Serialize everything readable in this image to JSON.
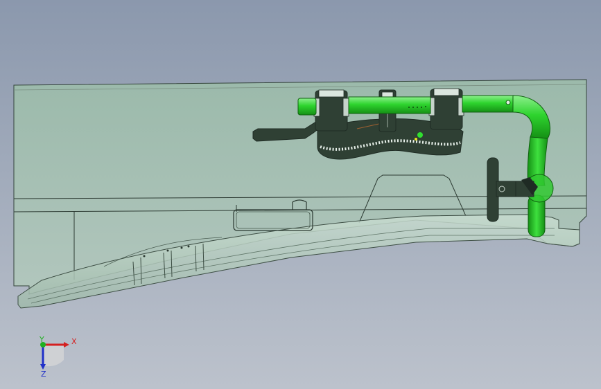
{
  "viewport": {
    "background_top": "#8b98ad",
    "background_bottom": "#bcc2cc"
  },
  "model": {
    "body_color": "#9dbcaa",
    "tube_color": "#2ed42e",
    "dark_part_color": "#2f4034",
    "edge_color": "#1f2b24"
  },
  "triad": {
    "x_label": "X",
    "y_label": "Y",
    "z_label": "Z",
    "x_color": "#d42020",
    "y_color": "#20b020",
    "z_color": "#2030c8"
  }
}
